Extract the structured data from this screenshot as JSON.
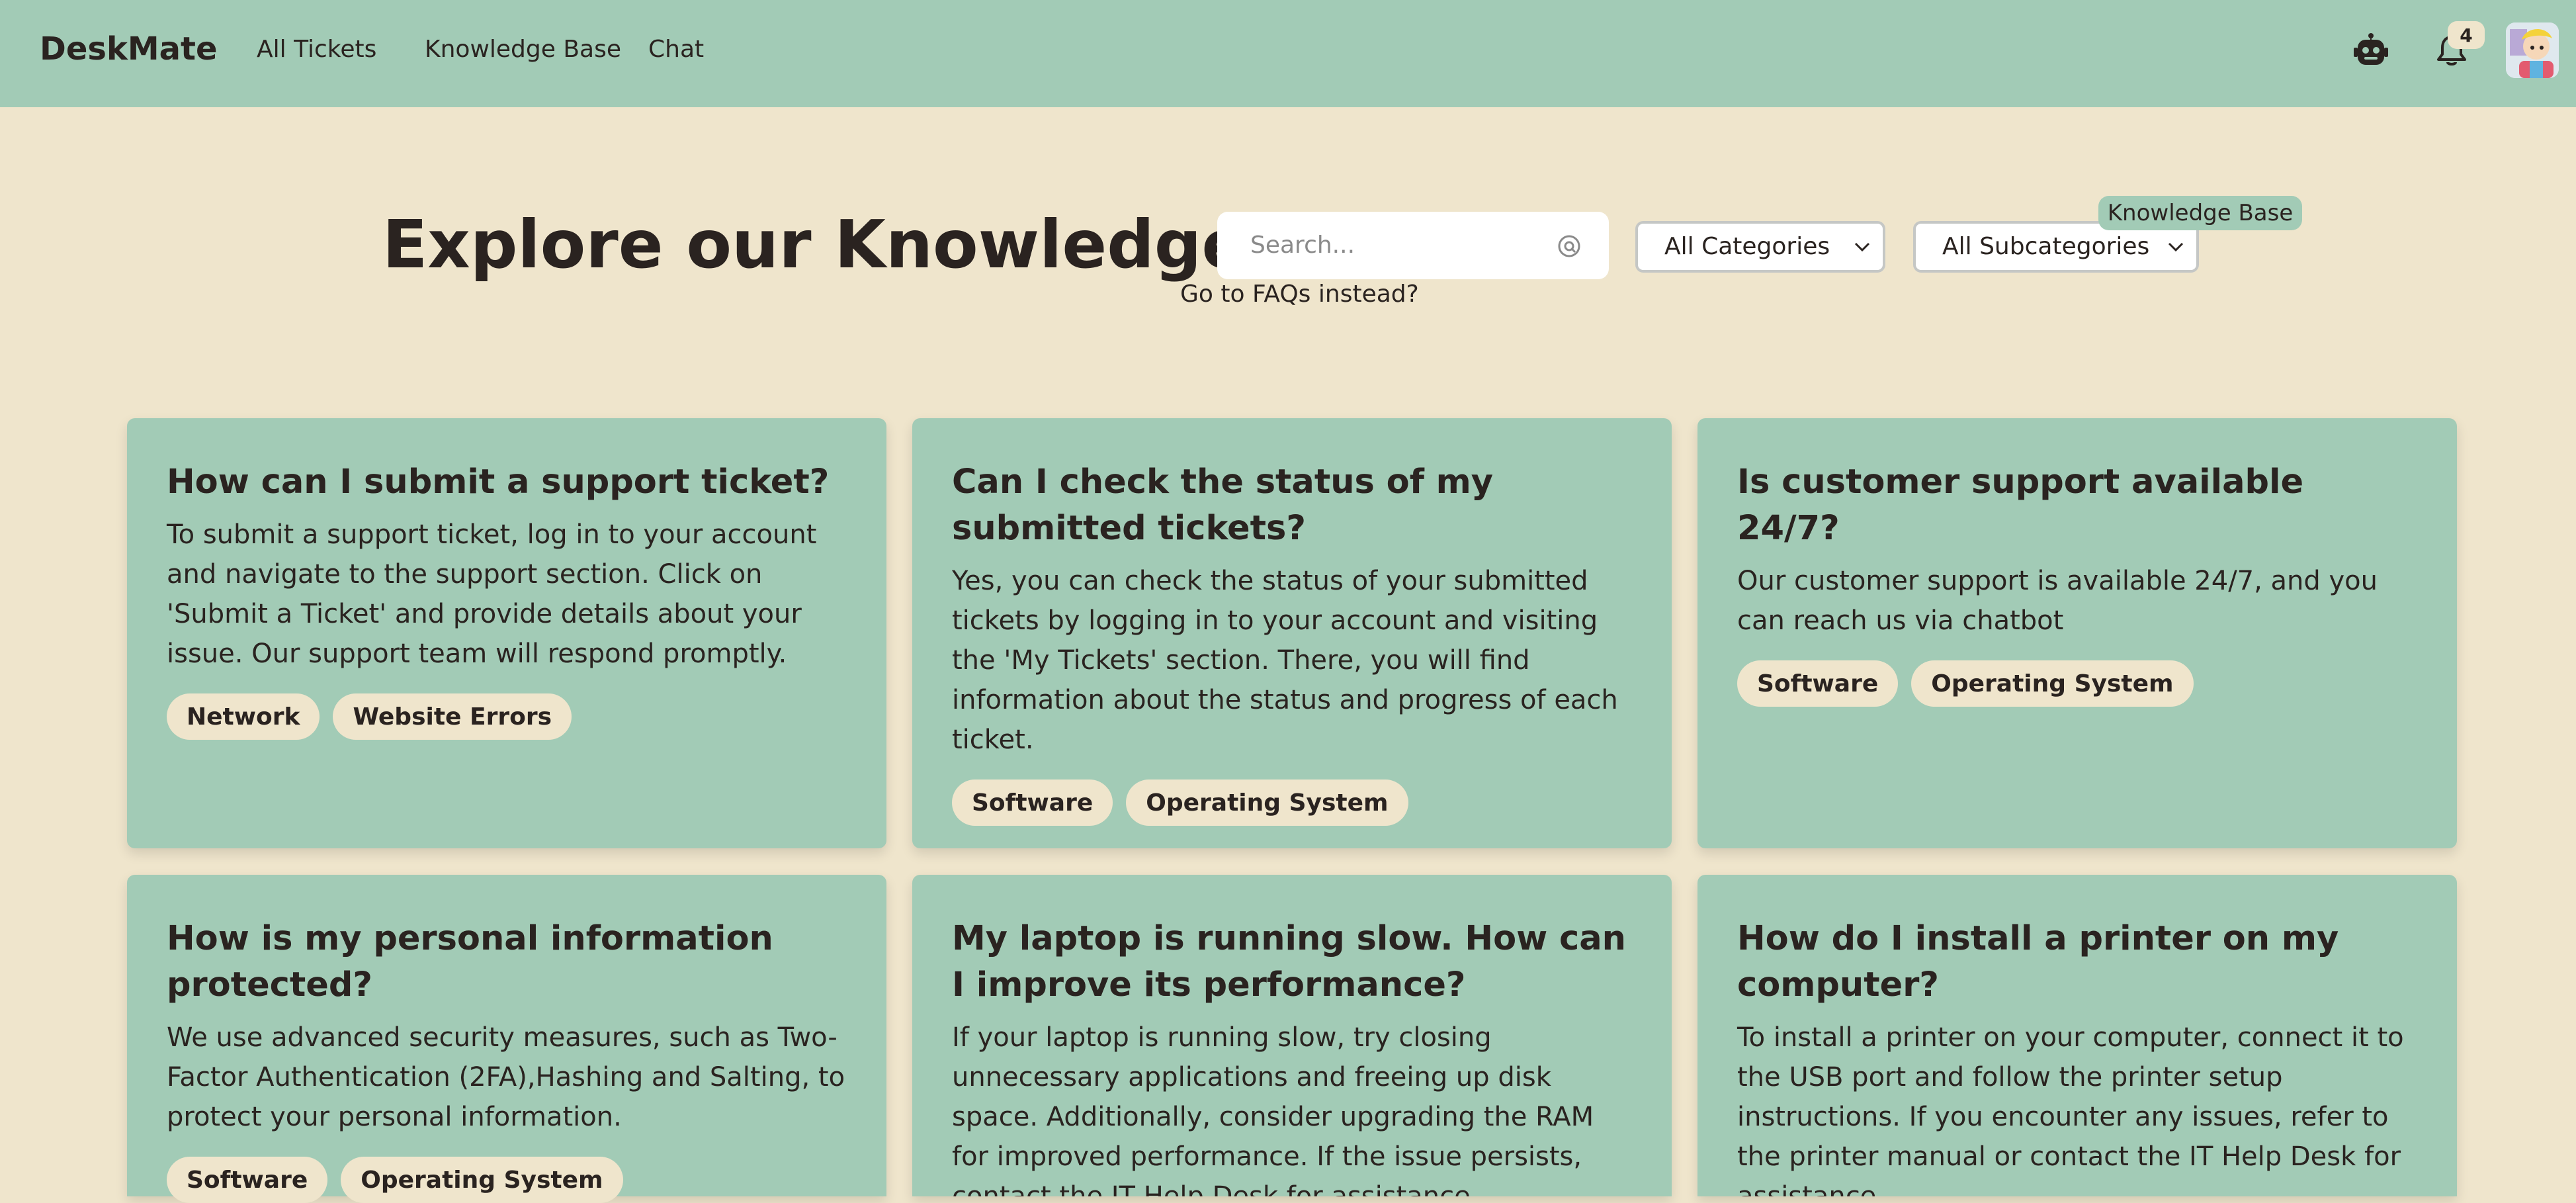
{
  "header": {
    "brand": "DeskMate",
    "nav": [
      "All Tickets",
      "Knowledge Base",
      "Chat"
    ],
    "notification_count": "4",
    "icons": [
      "robot-icon",
      "bell-icon",
      "avatar"
    ]
  },
  "hero": {
    "title": "Explore our Knowledge Base",
    "search_placeholder": "Search...",
    "category_select": "All Categories",
    "subcategory_select": "All Subcategories",
    "view_toggle": "Knowledge Base",
    "faq_link": "Go to FAQs instead?"
  },
  "articles": [
    {
      "title": "How can I submit a support ticket?",
      "body": "To submit a support ticket, log in to your account and navigate to the support section. Click on 'Submit a Ticket' and provide details about your issue. Our support team will respond promptly.",
      "tags": [
        "Network",
        "Website Errors"
      ]
    },
    {
      "title": "Can I check the status of my submitted tickets?",
      "body": "Yes, you can check the status of your submitted tickets by logging in to your account and visiting the 'My Tickets' section. There, you will find information about the status and progress of each ticket.",
      "tags": [
        "Software",
        "Operating System"
      ]
    },
    {
      "title": "Is customer support available 24/7?",
      "body": "Our customer support is available 24/7, and you can reach us via chatbot",
      "tags": [
        "Software",
        "Operating System"
      ]
    },
    {
      "title": "How is my personal information protected?",
      "body": "We use advanced security measures, such as Two-Factor Authentication (2FA),Hashing and Salting, to protect your personal information.",
      "tags": [
        "Software",
        "Operating System"
      ]
    },
    {
      "title": "My laptop is running slow. How can I improve its performance?",
      "body": "If your laptop is running slow, try closing unnecessary applications and freeing up disk space. Additionally, consider upgrading the RAM for improved performance. If the issue persists, contact the IT Help Desk for assistance.",
      "tags": []
    },
    {
      "title": "How do I install a printer on my computer?",
      "body": "To install a printer on your computer, connect it to the USB port and follow the printer setup instructions. If you encounter any issues, refer to the printer manual or contact the IT Help Desk for assistance.",
      "tags": []
    }
  ],
  "colors": {
    "background": "#efe5cc",
    "header": "#a2cbb6",
    "card": "#a2cbb6",
    "tag": "#efe5cc",
    "text": "#2a2320"
  }
}
